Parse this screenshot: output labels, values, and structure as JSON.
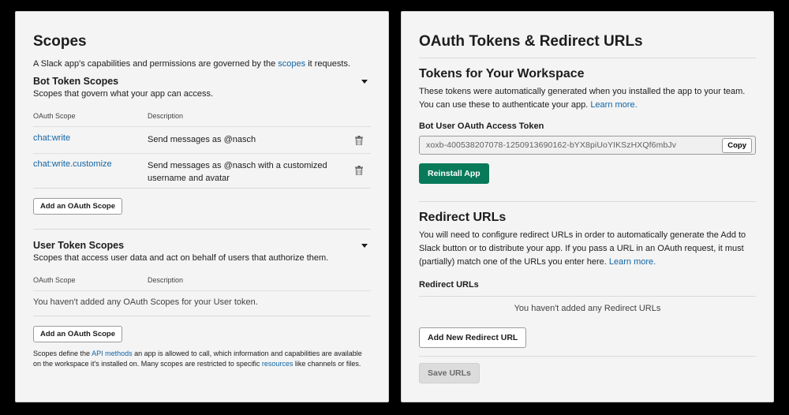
{
  "scopes": {
    "title": "Scopes",
    "intro_prefix": "A Slack app's capabilities and permissions are governed by the ",
    "intro_link": "scopes",
    "intro_suffix": " it requests.",
    "bot": {
      "title": "Bot Token Scopes",
      "subtitle": "Scopes that govern what your app can access.",
      "col_scope": "OAuth Scope",
      "col_desc": "Description",
      "rows": [
        {
          "scope": "chat:write",
          "desc": "Send messages as @nasch"
        },
        {
          "scope": "chat:write.customize",
          "desc": "Send messages as @nasch with a customized username and avatar"
        }
      ],
      "add_button": "Add an OAuth Scope"
    },
    "user": {
      "title": "User Token Scopes",
      "subtitle": "Scopes that access user data and act on behalf of users that authorize them.",
      "col_scope": "OAuth Scope",
      "col_desc": "Description",
      "empty": "You haven't added any OAuth Scopes for your User token.",
      "add_button": "Add an OAuth Scope"
    },
    "footer": {
      "p1": "Scopes define the ",
      "link1": "API methods",
      "p2": " an app is allowed to call, which information and capabilities are available on the workspace it's installed on. Many scopes are restricted to specific ",
      "link2": "resources",
      "p3": " like channels or files."
    }
  },
  "oauth": {
    "title": "OAuth Tokens & Redirect URLs",
    "tokens": {
      "title": "Tokens for Your Workspace",
      "desc": "These tokens were automatically generated when you installed the app to your team. You can use these to authenticate your app. ",
      "learn_more": "Learn more.",
      "token_label": "Bot User OAuth Access Token",
      "token_value": "xoxb-400538207078-1250913690162-bYX8piUoYIKSzHXQf6mbJv",
      "copy_button": "Copy",
      "reinstall_button": "Reinstall App"
    },
    "redirect": {
      "title": "Redirect URLs",
      "desc": "You will need to configure redirect URLs in order to automatically generate the Add to Slack button or to distribute your app. If you pass a URL in an OAuth request, it must (partially) match one of the URLs you enter here. ",
      "learn_more": "Learn more.",
      "list_label": "Redirect URLs",
      "empty": "You haven't added any Redirect URLs",
      "add_button": "Add New Redirect URL",
      "save_button": "Save URLs"
    }
  }
}
